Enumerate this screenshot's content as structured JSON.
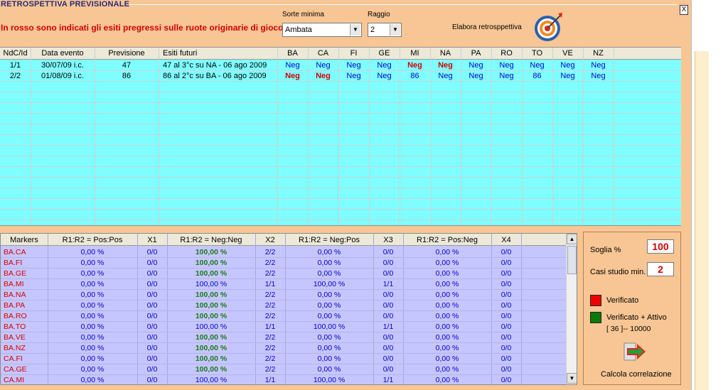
{
  "window": {
    "title": "RETROSPETTIVA PREVISIONALE",
    "close_label": "X",
    "notice": "In rosso sono indicati gli esiti pregressi sulle ruote originarie di gioco"
  },
  "controls": {
    "sorte_label": "Sorte minima",
    "sorte_value": "Ambata",
    "raggio_label": "Raggio",
    "raggio_value": "2",
    "elabora_label": "Elabora retrosppettiva",
    "target_icon": "target-icon"
  },
  "upper_table": {
    "columns": [
      "NdC/Id",
      "Data evento",
      "Previsione",
      "Esiti futuri",
      "BA",
      "CA",
      "FI",
      "GE",
      "MI",
      "NA",
      "PA",
      "RO",
      "TO",
      "VE",
      "NZ"
    ],
    "rows": [
      {
        "ndc": "1/1",
        "data": "30/07/09 i.c.",
        "prev": "47",
        "esiti": "47 al 3°c su NA - 06 ago 2009",
        "wheels": [
          {
            "v": "Neg",
            "r": false
          },
          {
            "v": "Neg",
            "r": false
          },
          {
            "v": "Neg",
            "r": false
          },
          {
            "v": "Neg",
            "r": false
          },
          {
            "v": "Neg",
            "r": true
          },
          {
            "v": "Neg",
            "r": true
          },
          {
            "v": "Neg",
            "r": false
          },
          {
            "v": "Neg",
            "r": false
          },
          {
            "v": "Neg",
            "r": false
          },
          {
            "v": "Neg",
            "r": false
          },
          {
            "v": "Neg",
            "r": false
          }
        ]
      },
      {
        "ndc": "2/2",
        "data": "01/08/09 i.c.",
        "prev": "86",
        "esiti": "86 al 2°c su BA - 06 ago 2009",
        "wheels": [
          {
            "v": "Neg",
            "r": true
          },
          {
            "v": "Neg",
            "r": true
          },
          {
            "v": "Neg",
            "r": false
          },
          {
            "v": "Neg",
            "r": false
          },
          {
            "v": "86",
            "r": false
          },
          {
            "v": "Neg",
            "r": false
          },
          {
            "v": "Neg",
            "r": false
          },
          {
            "v": "Neg",
            "r": false
          },
          {
            "v": "86",
            "r": false
          },
          {
            "v": "Neg",
            "r": false
          },
          {
            "v": "Neg",
            "r": false
          }
        ]
      }
    ]
  },
  "lower_table": {
    "columns": [
      "Markers",
      "R1:R2 = Pos:Pos",
      "X1",
      "R1:R2 = Neg:Neg",
      "X2",
      "R1:R2 = Neg:Pos",
      "X3",
      "R1:R2 = Pos:Neg",
      "X4"
    ],
    "rows": [
      [
        "BA.CA",
        "0,00 %",
        "0/0",
        "100,00 %",
        "2/2",
        "0,00 %",
        "0/0",
        "0,00 %",
        "0/0"
      ],
      [
        "BA.FI",
        "0,00 %",
        "0/0",
        "100,00 %",
        "2/2",
        "0,00 %",
        "0/0",
        "0,00 %",
        "0/0"
      ],
      [
        "BA.GE",
        "0,00 %",
        "0/0",
        "100,00 %",
        "2/2",
        "0,00 %",
        "0/0",
        "0,00 %",
        "0/0"
      ],
      [
        "BA.MI",
        "0,00 %",
        "0/0",
        "100,00 %",
        "1/1",
        "100,00 %",
        "1/1",
        "0,00 %",
        "0/0"
      ],
      [
        "BA.NA",
        "0,00 %",
        "0/0",
        "100,00 %",
        "2/2",
        "0,00 %",
        "0/0",
        "0,00 %",
        "0/0"
      ],
      [
        "BA.PA",
        "0,00 %",
        "0/0",
        "100,00 %",
        "2/2",
        "0,00 %",
        "0/0",
        "0,00 %",
        "0/0"
      ],
      [
        "BA.RO",
        "0,00 %",
        "0/0",
        "100,00 %",
        "2/2",
        "0,00 %",
        "0/0",
        "0,00 %",
        "0/0"
      ],
      [
        "BA.TO",
        "0,00 %",
        "0/0",
        "100,00 %",
        "1/1",
        "100,00 %",
        "1/1",
        "0,00 %",
        "0/0"
      ],
      [
        "BA.VE",
        "0,00 %",
        "0/0",
        "100,00 %",
        "2/2",
        "0,00 %",
        "0/0",
        "0,00 %",
        "0/0"
      ],
      [
        "BA.NZ",
        "0,00 %",
        "0/0",
        "100,00 %",
        "2/2",
        "0,00 %",
        "0/0",
        "0,00 %",
        "0/0"
      ],
      [
        "CA.FI",
        "0,00 %",
        "0/0",
        "100,00 %",
        "2/2",
        "0,00 %",
        "0/0",
        "0,00 %",
        "0/0"
      ],
      [
        "CA.GE",
        "0,00 %",
        "0/0",
        "100,00 %",
        "2/2",
        "0,00 %",
        "0/0",
        "0,00 %",
        "0/0"
      ],
      [
        "CA.MI",
        "0,00 %",
        "0/0",
        "100,00 %",
        "1/1",
        "100,00 %",
        "1/1",
        "0,00 %",
        "0/0"
      ]
    ],
    "green_flags": [
      true,
      true,
      true,
      false,
      true,
      true,
      true,
      false,
      true,
      true,
      true,
      true,
      false
    ]
  },
  "panel": {
    "soglia_label": "Soglia %",
    "soglia_value": "100",
    "casi_label": "Casi studio min.",
    "casi_value": "2",
    "verificato_label": "Verificato",
    "verificato_color": "#ee0000",
    "attivo_label": "Verificato + Attivo",
    "attivo_color": "#0a7a0a",
    "range_label": "[ 36 ]-- 10000",
    "calcola_label": "Calcola correlazione",
    "calcola_icon": "arrow-right-icon"
  },
  "colors": {
    "window_bg": "#f7c694",
    "upper_grid_bg": "#7fffff",
    "lower_grid_bg": "#c6c6ff",
    "accent_red": "#d40000",
    "neg_blue": "#0000c8"
  }
}
